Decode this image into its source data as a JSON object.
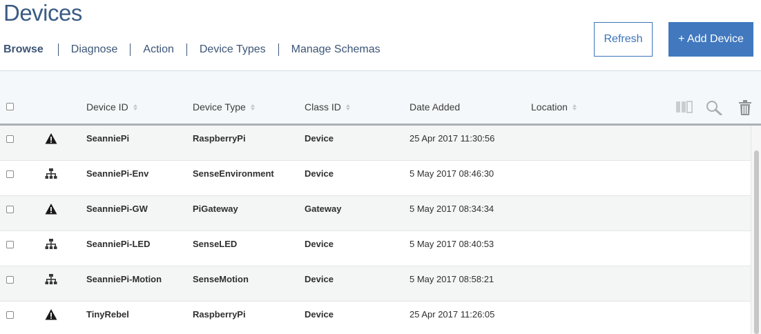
{
  "page": {
    "title": "Devices"
  },
  "tabs": [
    {
      "label": "Browse",
      "active": true
    },
    {
      "label": "Diagnose"
    },
    {
      "label": "Action"
    },
    {
      "label": "Device Types"
    },
    {
      "label": "Manage Schemas"
    }
  ],
  "buttons": {
    "refresh": "Refresh",
    "add_device": "+ Add Device"
  },
  "table": {
    "columns": [
      {
        "label": "Device ID",
        "sortable": true
      },
      {
        "label": "Device Type",
        "sortable": true
      },
      {
        "label": "Class ID",
        "sortable": true
      },
      {
        "label": "Date Added",
        "sortable": false
      },
      {
        "label": "Location",
        "sortable": true
      }
    ],
    "tools": [
      "columns-icon",
      "search-icon",
      "trash-icon"
    ],
    "rows": [
      {
        "icon": "warning-icon",
        "device_id": "SeanniePi",
        "device_type": "RaspberryPi",
        "class_id": "Device",
        "date_added": "25 Apr 2017 11:30:56",
        "location": ""
      },
      {
        "icon": "network-icon",
        "device_id": "SeanniePi-Env",
        "device_type": "SenseEnvironment",
        "class_id": "Device",
        "date_added": "5 May 2017 08:46:30",
        "location": ""
      },
      {
        "icon": "warning-icon",
        "device_id": "SeanniePi-GW",
        "device_type": "PiGateway",
        "class_id": "Gateway",
        "date_added": "5 May 2017 08:34:34",
        "location": ""
      },
      {
        "icon": "network-icon",
        "device_id": "SeanniePi-LED",
        "device_type": "SenseLED",
        "class_id": "Device",
        "date_added": "5 May 2017 08:40:53",
        "location": ""
      },
      {
        "icon": "network-icon",
        "device_id": "SeanniePi-Motion",
        "device_type": "SenseMotion",
        "class_id": "Device",
        "date_added": "5 May 2017 08:58:21",
        "location": ""
      },
      {
        "icon": "warning-icon",
        "device_id": "TinyRebel",
        "device_type": "RaspberryPi",
        "class_id": "Device",
        "date_added": "25 Apr 2017 11:26:05",
        "location": ""
      }
    ]
  },
  "colors": {
    "title": "#3b5b84",
    "primary": "#4178be",
    "header_bg": "#f4f8fa"
  }
}
